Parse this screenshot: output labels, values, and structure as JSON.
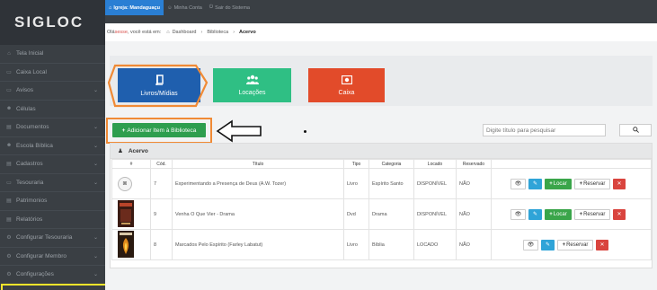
{
  "app": {
    "logo": "SIGLOC"
  },
  "sidebar": {
    "items": [
      {
        "label": "Tela Inicial",
        "icon": "home-icon",
        "glyph": "⌂",
        "chevron": false
      },
      {
        "label": "Caixa Local",
        "icon": "cash-icon",
        "glyph": "▭",
        "chevron": false
      },
      {
        "label": "Avisos",
        "icon": "bell-icon",
        "glyph": "▭",
        "chevron": true
      },
      {
        "label": "Células",
        "icon": "users-icon",
        "glyph": "☻",
        "chevron": false
      },
      {
        "label": "Documentos",
        "icon": "document-icon",
        "glyph": "▤",
        "chevron": true
      },
      {
        "label": "Escola Bíblica",
        "icon": "school-icon",
        "glyph": "☻",
        "chevron": true
      },
      {
        "label": "Cadastros",
        "icon": "list-icon",
        "glyph": "▤",
        "chevron": true
      },
      {
        "label": "Tesouraria",
        "icon": "treasury-icon",
        "glyph": "▭",
        "chevron": true
      },
      {
        "label": "Patrimonios",
        "icon": "asset-icon",
        "glyph": "▤",
        "chevron": false
      },
      {
        "label": "Relatórios",
        "icon": "report-icon",
        "glyph": "▤",
        "chevron": false
      },
      {
        "label": "Configurar Tesouraria",
        "icon": "gear-icon",
        "glyph": "⚙",
        "chevron": true
      },
      {
        "label": "Configurar Membro",
        "icon": "gear-icon",
        "glyph": "⚙",
        "chevron": true
      },
      {
        "label": "Configurações",
        "icon": "gear-icon",
        "glyph": "⚙",
        "chevron": true
      }
    ]
  },
  "topbar": {
    "church": "Igreja: Mandaguaçu",
    "account": "Minha Conta",
    "logout": "Sair do Sistema"
  },
  "breadcrumb": {
    "greeting_prefix": "Olá ",
    "user": "sesse",
    "greeting_suffix": ", você está em:",
    "items": [
      "Dashboard",
      "Biblioteca",
      "Acervo"
    ],
    "separator": "›"
  },
  "tiles": [
    {
      "label": "Livros/Mídias",
      "icon": "book-icon",
      "glyph": "📖",
      "color": "#1f5fae"
    },
    {
      "label": "Locações",
      "icon": "group-icon",
      "glyph": "👥",
      "color": "#2fbf84"
    },
    {
      "label": "Caixa",
      "icon": "money-icon",
      "glyph": "💵",
      "color": "#e24b2a"
    }
  ],
  "add_button": {
    "label": "Adicionar Item à Biblioteca",
    "color": "#2e9e4e"
  },
  "search": {
    "placeholder": "Digite título para pesquisar"
  },
  "panel": {
    "title": "Acervo"
  },
  "table": {
    "headers": [
      "#",
      "Cód.",
      "Título",
      "Tipo",
      "Categoria",
      "Locado",
      "Reservado",
      ""
    ],
    "rows": [
      {
        "cover": "placeholder-camera-icon",
        "code": "7",
        "title": "Experimentando a Presença de Deus (A.W. Tozer)",
        "type": "Livro",
        "category": "Espírito Santo",
        "status": "DISPONÍVEL",
        "reserved": "NÃO",
        "can_rent": true
      },
      {
        "cover": "book-cover-vermelha",
        "code": "9",
        "title": "Venha O Que Vier - Drama",
        "type": "Dvd",
        "category": "Drama",
        "status": "DISPONÍVEL",
        "reserved": "NÃO",
        "can_rent": true
      },
      {
        "cover": "book-cover-fire",
        "code": "8",
        "title": "Marcados Pelo Espírito (Farley Labatut)",
        "type": "Livro",
        "category": "Bíblia",
        "status": "LOCADO",
        "reserved": "NÃO",
        "can_rent": false
      }
    ]
  },
  "actions": {
    "rent_label": "Locar",
    "reserve_label": "Reservar"
  },
  "colors": {
    "accent_orange": "#f08a35",
    "highlight_yellow": "#f5e52b",
    "topbar_active": "#2a7fd4"
  }
}
